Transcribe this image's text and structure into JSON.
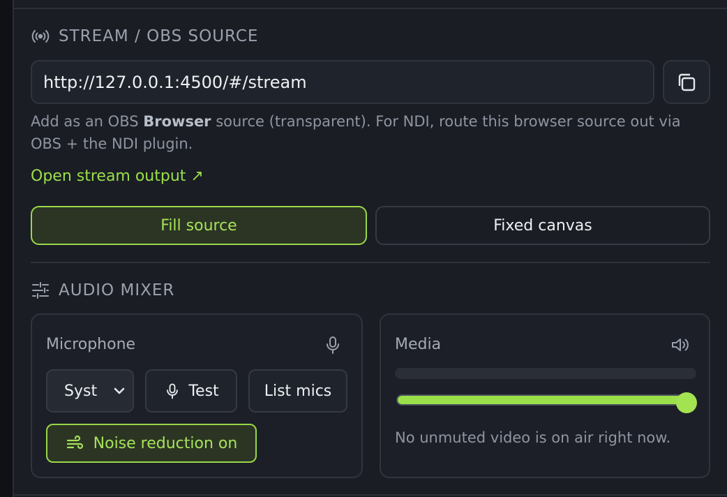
{
  "stream": {
    "heading": "STREAM / OBS SOURCE",
    "url": "http://127.0.0.1:4500/#/stream",
    "help_prefix": "Add as an OBS ",
    "help_bold": "Browser",
    "help_suffix": " source (transparent). For NDI, route this browser source out via OBS + the NDI plugin.",
    "open_link": "Open stream output ↗",
    "modes": [
      {
        "label": "Fill source",
        "selected": true
      },
      {
        "label": "Fixed canvas",
        "selected": false
      }
    ]
  },
  "audio": {
    "heading": "AUDIO MIXER",
    "microphone": {
      "title": "Microphone",
      "device_select": "Syst",
      "test_label": "Test",
      "list_label": "List mics",
      "noise_label": "Noise reduction on"
    },
    "media": {
      "title": "Media",
      "level": 0,
      "volume": 1.0,
      "note": "No unmuted video is on air right now."
    }
  },
  "colors": {
    "accent": "#9be04a",
    "panel": "#1a1d24",
    "border": "#2f343e"
  }
}
